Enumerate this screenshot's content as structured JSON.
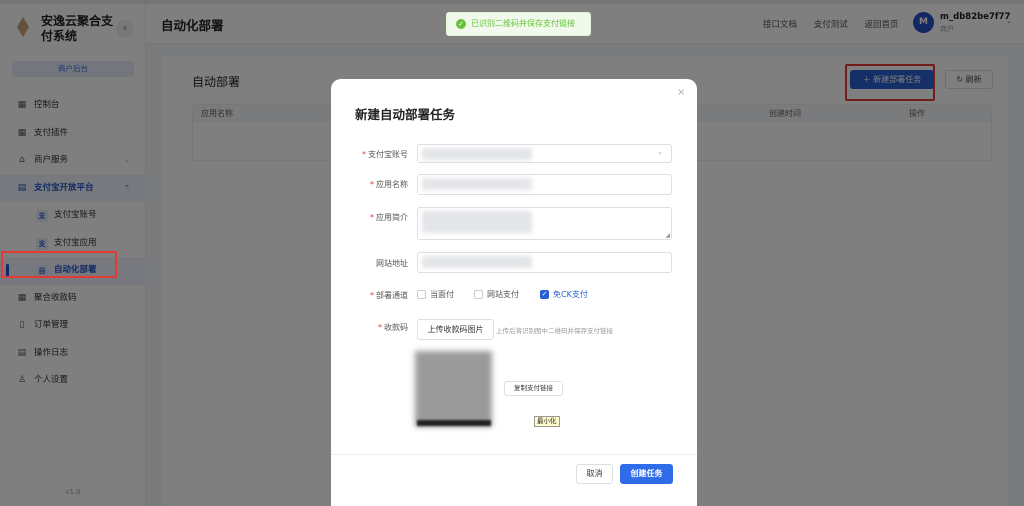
{
  "sidebar": {
    "system_title": "安逸云聚合支付系统",
    "collapse_icon": "‹",
    "role_badge": "商户后台",
    "version": "v1.0",
    "items": [
      {
        "label": "控制台",
        "icon": "▦"
      },
      {
        "label": "支付插件",
        "icon": "▦"
      },
      {
        "label": "商户服务",
        "icon": "⌂",
        "chevron": "⌄"
      },
      {
        "label": "支付宝开放平台",
        "icon": "▤",
        "chevron": "⌃"
      },
      {
        "label": "支付宝账号",
        "icon": "支"
      },
      {
        "label": "支付宝应用",
        "icon": "支"
      },
      {
        "label": "自动化部署",
        "icon": "自"
      },
      {
        "label": "聚合收款码",
        "icon": "▦"
      },
      {
        "label": "订单管理",
        "icon": "▯"
      },
      {
        "label": "操作日志",
        "icon": "▤"
      },
      {
        "label": "个人设置",
        "icon": "♙"
      }
    ]
  },
  "header": {
    "title": "自动化部署",
    "links": [
      "接口文档",
      "支付测试",
      "返回首页"
    ],
    "avatar_letter": "M",
    "username": "m_db82be7f77",
    "user_role": "商户",
    "caret": "⌄"
  },
  "toast": {
    "icon": "✓",
    "text": "已识别二维码并保存支付链接"
  },
  "content": {
    "section_title": "自动部署",
    "new_button": "＋ 新建部署任务",
    "refresh_button": "↻ 刷新",
    "table_headers": [
      "应用名称",
      "创建时间",
      "操作"
    ]
  },
  "modal": {
    "title": "新建自动部署任务",
    "close_icon": "×",
    "fields": {
      "alipay_account": {
        "label": "支付宝账号",
        "required": "*"
      },
      "app_name": {
        "label": "应用名称",
        "required": "*"
      },
      "app_intro": {
        "label": "应用简介",
        "required": "*"
      },
      "website": {
        "label": "网站地址"
      },
      "channels": {
        "label": "部署通道",
        "required": "*"
      },
      "qrcode": {
        "label": "收款码",
        "required": "*"
      }
    },
    "channel_options": [
      {
        "label": "当面付",
        "checked": false
      },
      {
        "label": "网站支付",
        "checked": false
      },
      {
        "label": "免CK支付",
        "checked": true
      }
    ],
    "check_mark": "✓",
    "select_caret": "⌄",
    "upload_button": "上传收款码图片",
    "upload_hint": "上传后将识别图中二维码并保存支付链接",
    "copy_button": "复制支付链接",
    "minimize_tag": "最小化",
    "cancel_button": "取消",
    "create_button": "创建任务"
  },
  "colors": {
    "primary": "#2a5fd0",
    "highlight_red": "#e53935",
    "success": "#67c23a"
  }
}
